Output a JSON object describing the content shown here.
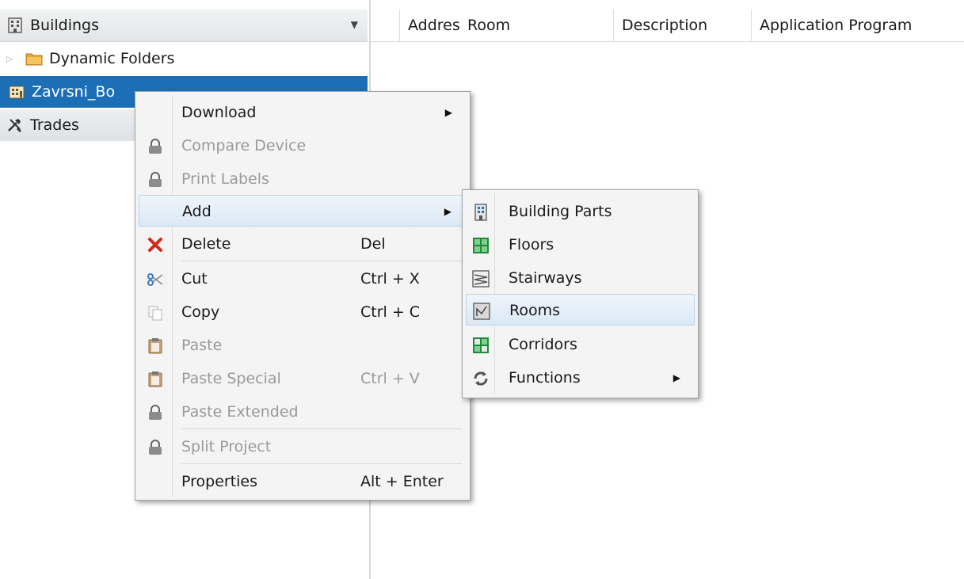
{
  "tree": {
    "header_title": "Buildings",
    "items": [
      {
        "label": "Dynamic Folders"
      },
      {
        "label": "Zavrsni_Bo"
      },
      {
        "label": "Trades"
      }
    ]
  },
  "grid": {
    "columns": [
      "Addres",
      "Room",
      "Description",
      "Application Program"
    ]
  },
  "context_menu": {
    "items": [
      {
        "label": "Download",
        "shortcut": ""
      },
      {
        "label": "Compare Device",
        "shortcut": ""
      },
      {
        "label": "Print Labels",
        "shortcut": ""
      },
      {
        "label": "Add",
        "shortcut": ""
      },
      {
        "label": "Delete",
        "shortcut": "Del"
      },
      {
        "label": "Cut",
        "shortcut": "Ctrl + X"
      },
      {
        "label": "Copy",
        "shortcut": "Ctrl + C"
      },
      {
        "label": "Paste",
        "shortcut": ""
      },
      {
        "label": "Paste Special",
        "shortcut": "Ctrl + V"
      },
      {
        "label": "Paste Extended",
        "shortcut": ""
      },
      {
        "label": "Split Project",
        "shortcut": ""
      },
      {
        "label": "Properties",
        "shortcut": "Alt + Enter"
      }
    ]
  },
  "submenu": {
    "items": [
      {
        "label": "Building Parts"
      },
      {
        "label": "Floors"
      },
      {
        "label": "Stairways"
      },
      {
        "label": "Rooms"
      },
      {
        "label": "Corridors"
      },
      {
        "label": "Functions"
      }
    ]
  },
  "colors": {
    "selection": "#1d6fb5",
    "hover_bg": "#dbe9f5",
    "delete_red": "#d9261c",
    "floor_green": "#1f8a3a"
  }
}
